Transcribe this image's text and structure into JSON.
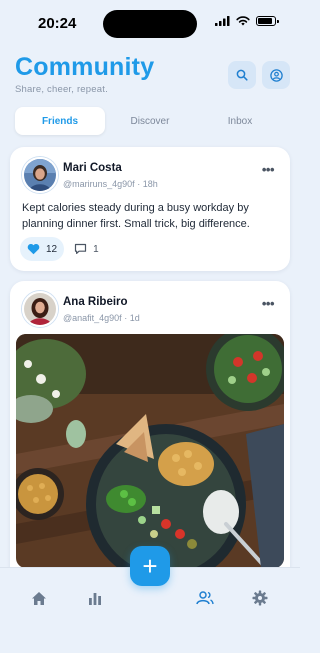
{
  "status": {
    "time": "20:24"
  },
  "header": {
    "title": "Community",
    "subtitle": "Share, cheer, repeat."
  },
  "tabs": [
    {
      "label": "Friends",
      "active": true
    },
    {
      "label": "Discover",
      "active": false
    },
    {
      "label": "Inbox",
      "active": false
    }
  ],
  "posts": [
    {
      "author": "Mari Costa",
      "handle": "@mariruns_4g90f",
      "time": "18h",
      "text": "Kept calories steady during a busy workday by planning dinner first. Small trick, big difference.",
      "likes": "12",
      "comments": "1"
    },
    {
      "author": "Ana Ribeiro",
      "handle": "@anafit_4g90f",
      "time": "1d"
    }
  ],
  "fab": {
    "label": "+"
  },
  "colors": {
    "accent": "#1f9ae8",
    "background": "#eaf1fa"
  }
}
